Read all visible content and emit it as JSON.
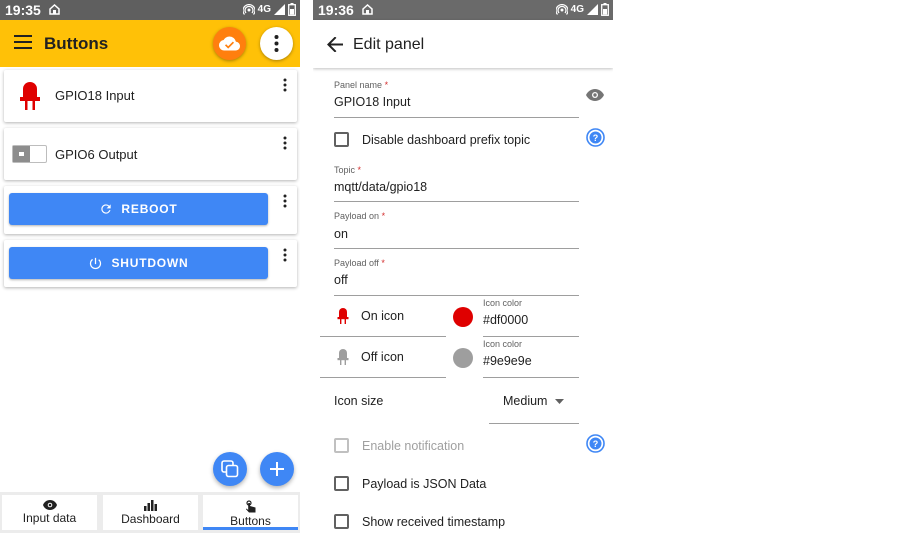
{
  "left": {
    "status": {
      "time": "19:35",
      "net": "4G"
    },
    "appbar": {
      "title": "Buttons"
    },
    "cards": [
      {
        "label": "GPIO18 Input"
      },
      {
        "label": "GPIO6 Output"
      }
    ],
    "buttons": [
      {
        "label": "REBOOT"
      },
      {
        "label": "SHUTDOWN"
      }
    ],
    "nav": [
      {
        "label": "Input data"
      },
      {
        "label": "Dashboard"
      },
      {
        "label": "Buttons"
      }
    ],
    "colors": {
      "accent": "#ffc107",
      "brand": "#3f87f5",
      "cloud": "#ff7f0e",
      "on": "#df0000"
    }
  },
  "right": {
    "status": {
      "time": "19:36",
      "net": "4G"
    },
    "appbar": {
      "title": "Edit panel"
    },
    "panel_name": {
      "label": "Panel name",
      "required": "*",
      "value": "GPIO18 Input"
    },
    "disable_prefix": {
      "label": "Disable dashboard prefix topic",
      "checked": false
    },
    "topic": {
      "label": "Topic",
      "required": "*",
      "value": "mqtt/data/gpio18"
    },
    "payload_on": {
      "label": "Payload on",
      "required": "*",
      "value": "on"
    },
    "payload_off": {
      "label": "Payload off",
      "required": "*",
      "value": "off"
    },
    "on_icon": {
      "label": "On icon",
      "color_label": "Icon color",
      "color_value": "#df0000"
    },
    "off_icon": {
      "label": "Off icon",
      "color_label": "Icon color",
      "color_value": "#9e9e9e"
    },
    "icon_size": {
      "label": "Icon size",
      "value": "Medium"
    },
    "enable_notification": {
      "label": "Enable notification",
      "checked": false,
      "disabled": true
    },
    "payload_json": {
      "label": "Payload is JSON Data",
      "checked": false
    },
    "show_timestamp": {
      "label": "Show received timestamp",
      "checked": false
    }
  }
}
